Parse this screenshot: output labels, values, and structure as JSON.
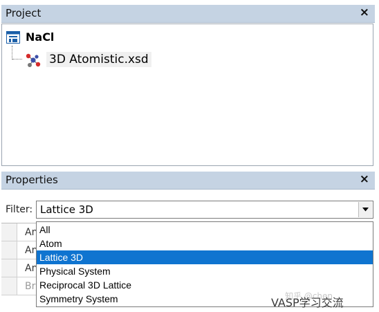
{
  "project_pane": {
    "title": "Project",
    "close": "×",
    "tree": {
      "root_label": "NaCl",
      "children": [
        {
          "label": "3D Atomistic.xsd"
        }
      ]
    }
  },
  "properties_pane": {
    "title": "Properties",
    "close": "×",
    "filter": {
      "label": "Filter:",
      "value": "Lattice 3D",
      "options": [
        "All",
        "Atom",
        "Lattice 3D",
        "Physical System",
        "Reciprocal 3D Lattice",
        "Symmetry System"
      ],
      "selected_index": 2
    },
    "grid_rows": [
      {
        "name": "An"
      },
      {
        "name": "An"
      },
      {
        "name": "An"
      },
      {
        "name": "Br"
      }
    ]
  },
  "watermark": {
    "text": "VASP学习交流",
    "faint": "知乎 @chen"
  },
  "colors": {
    "header_bg": "#c5d3e3",
    "selection": "#0f74d0"
  }
}
